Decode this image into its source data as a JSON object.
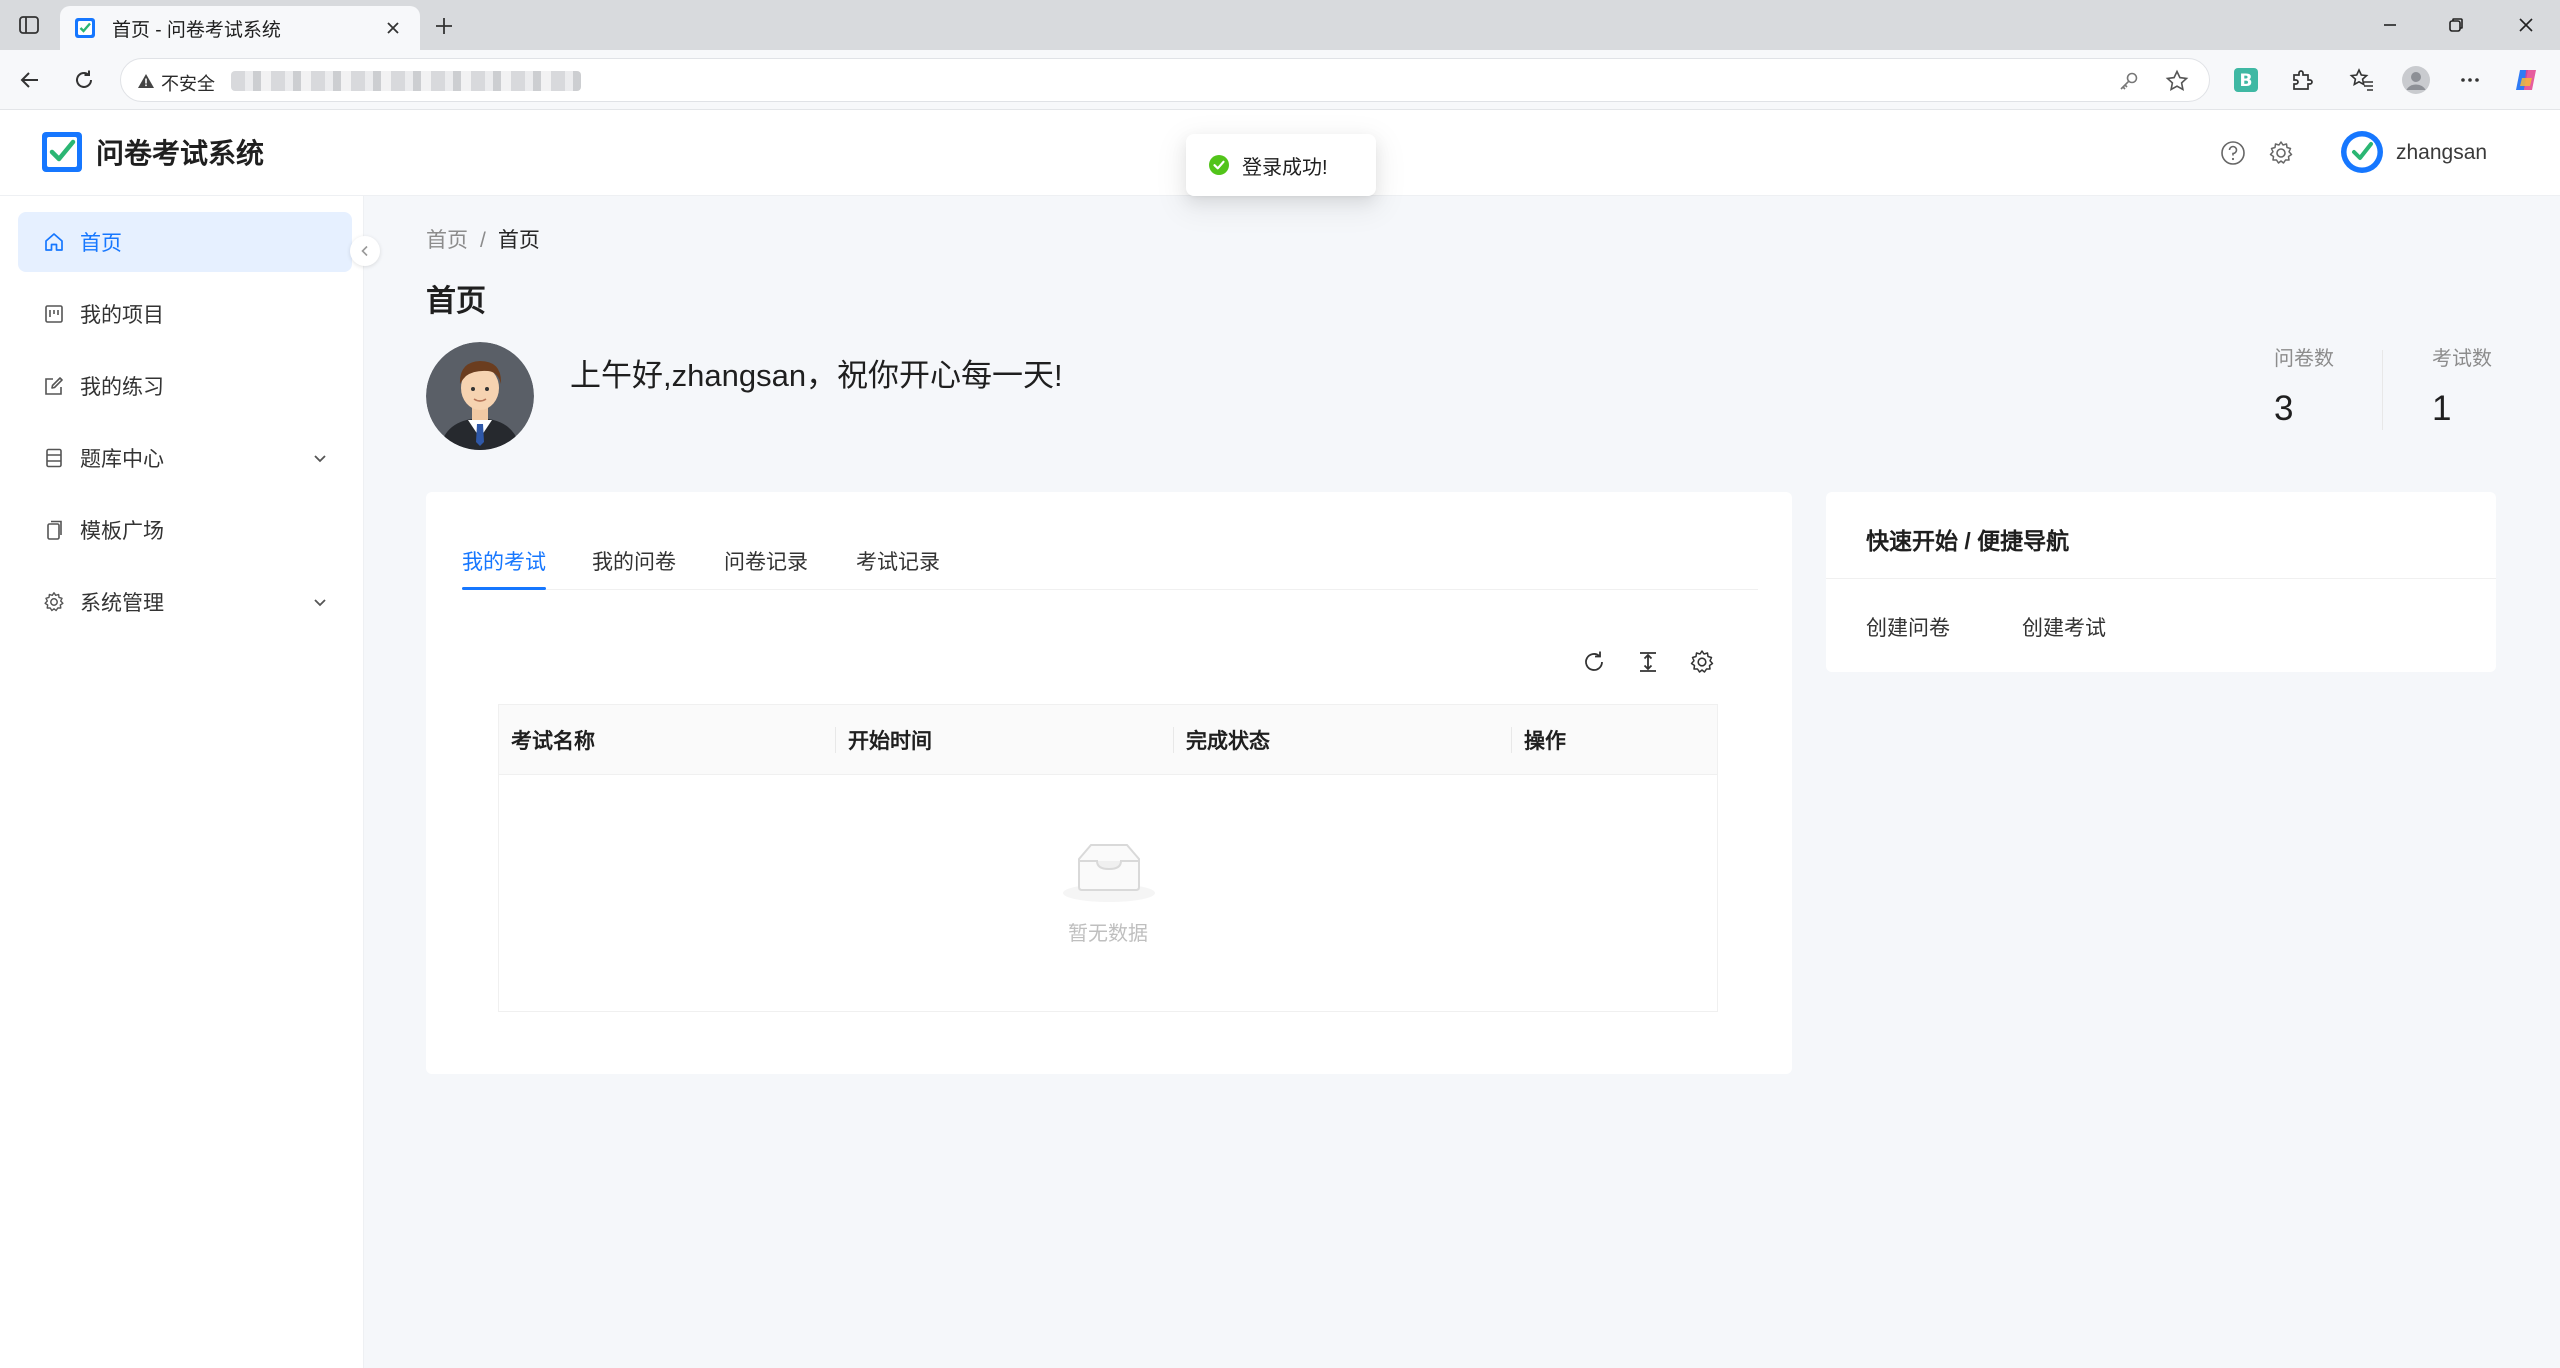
{
  "browser": {
    "tab_title": "首页 - 问卷考试系统",
    "security_label": "不安全"
  },
  "app": {
    "brand": "问卷考试系统",
    "username": "zhangsan",
    "toast": "登录成功!"
  },
  "sidebar": {
    "items": [
      {
        "label": "首页",
        "icon": "home-icon",
        "active": true
      },
      {
        "label": "我的项目",
        "icon": "project-icon"
      },
      {
        "label": "我的练习",
        "icon": "edit-icon"
      },
      {
        "label": "题库中心",
        "icon": "book-icon",
        "expandable": true
      },
      {
        "label": "模板广场",
        "icon": "copy-icon"
      },
      {
        "label": "系统管理",
        "icon": "gear-icon",
        "expandable": true
      }
    ]
  },
  "breadcrumb": [
    "首页",
    "/",
    "首页"
  ],
  "page_title": "首页",
  "greeting": "上午好,zhangsan，祝你开心每一天!",
  "stats": [
    {
      "label": "问卷数",
      "value": "3"
    },
    {
      "label": "考试数",
      "value": "1"
    }
  ],
  "tabs": [
    "我的考试",
    "我的问卷",
    "问卷记录",
    "考试记录"
  ],
  "table": {
    "columns": [
      "考试名称",
      "开始时间",
      "完成状态",
      "操作"
    ],
    "empty_text": "暂无数据"
  },
  "quick_nav": {
    "title": "快速开始 / 便捷导航",
    "links": [
      "创建问卷",
      "创建考试"
    ]
  },
  "colors": {
    "primary": "#1677ff",
    "success": "#52c41a",
    "menu_active_bg": "#e6f0ff"
  }
}
